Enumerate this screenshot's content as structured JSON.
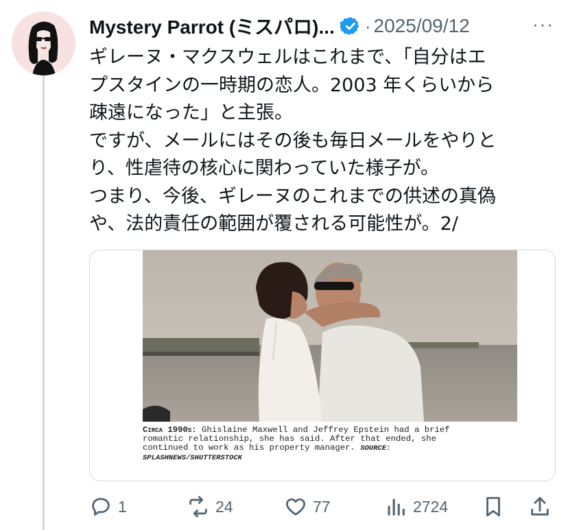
{
  "tweet": {
    "author_name": "Mystery Parrot (ミスパロ)...",
    "separator": "·",
    "date": "2025/09/12",
    "more_label": "···",
    "text_lines": [
      "ギレーヌ・マクスウェルはこれまで、「自分はエ",
      "プスタインの一時期の恋人。2003 年くらいから",
      "疎遠になった」と主張。",
      "ですが、メールにはその後も毎日メールをやりと",
      "り、性虐待の核心に関わっていた様子が。",
      "つまり、今後、ギレーヌのこれまでの供述の真偽",
      "や、法的責任の範囲が覆される可能性が。2/"
    ]
  },
  "media": {
    "caption_lead": "Circa 1990s:",
    "caption_lines": [
      " Ghislaine Maxwell and Jeffrey Epstein had a brief",
      "romantic relationship, she has said. After that ended, she",
      "continued to work as his property manager. "
    ],
    "caption_source_1": "SOURCE:",
    "caption_source_2": "SPLASHNEWS/SHUTTERSTOCK"
  },
  "actions": {
    "reply_count": "1",
    "retweet_count": "24",
    "like_count": "77",
    "views_count": "2724"
  },
  "colors": {
    "secondary_text": "#536471",
    "verified_blue": "#1d9bf0",
    "border": "#cfd9de"
  },
  "icons": [
    "verified-badge-icon",
    "reply-icon",
    "retweet-icon",
    "like-icon",
    "views-icon",
    "bookmark-icon",
    "share-icon"
  ]
}
